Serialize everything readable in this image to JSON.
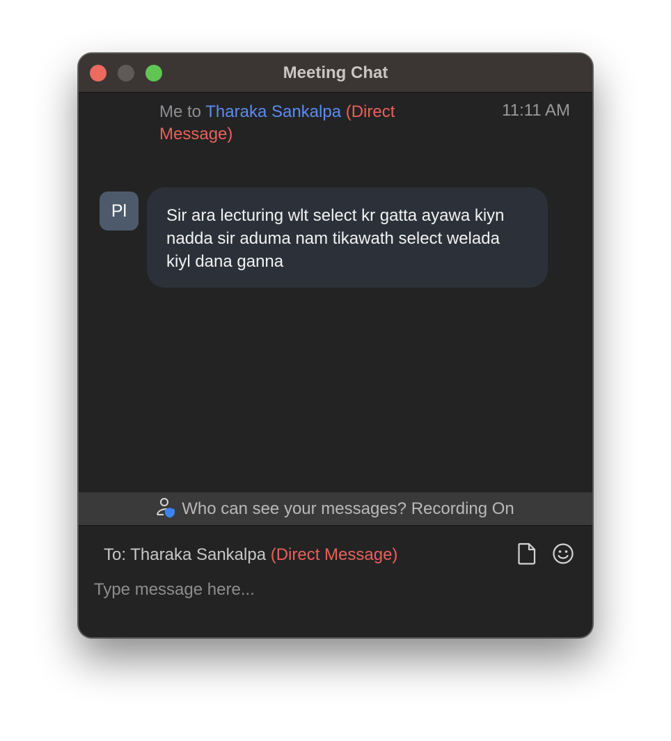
{
  "window": {
    "title": "Meeting Chat"
  },
  "message": {
    "sender_prefix": "Me to ",
    "recipient": "Tharaka Sankalpa",
    "dm_tag": " (Direct Message)",
    "timestamp": "11:11 AM",
    "avatar_initials": "Pl",
    "text": "Sir ara lecturing wlt select kr gatta ayawa kiyn nadda sir aduma nam tikawath select welada kiyl dana ganna"
  },
  "notice": {
    "text": "Who can see your messages? Recording On"
  },
  "compose": {
    "to_label": "To: Tharaka Sankalpa",
    "to_dm_tag": " (Direct Message)",
    "placeholder": "Type message here..."
  },
  "icons": {
    "privacy": "person-shield-icon",
    "file": "file-icon",
    "emoji": "emoji-icon"
  },
  "colors": {
    "recipient": "#5a8cf2",
    "direct_message": "#e8615b",
    "close": "#ed6a5e",
    "zoom": "#61c554"
  }
}
